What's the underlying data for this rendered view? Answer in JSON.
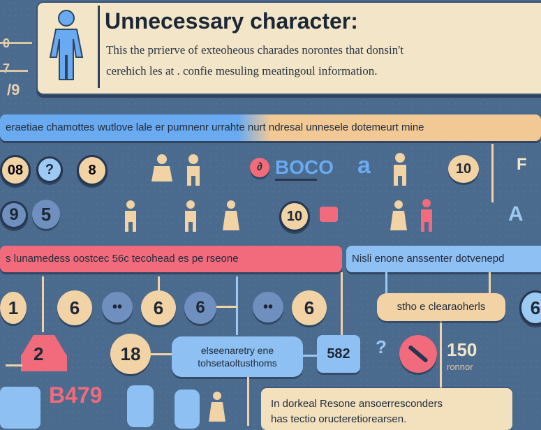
{
  "header": {
    "title": "Unnecessary character:",
    "line1": "This the prrierve of exteoheous charades norontes that donsin't",
    "line2": "cerehich les at . confie mesuling meatingoul information."
  },
  "banners": {
    "top": "eraetiae chamottes wutlove lale er pumnenr urrahte nurt ndresal unnesele dotemeurt mine",
    "red": "s lunamedess oostcec 56c tecohead es pe rseone",
    "blue": "Nisli enone anssenter dotvenepd"
  },
  "labels": {
    "beige_pill": "stho e clearaoherls",
    "blue_pill_line1": "elseenaretry ene",
    "blue_pill_line2": "tohsetaoltusthoms",
    "note_line1": "In dorkeal Resone ansoerresconders",
    "note_line2": "has tectio oructeretiorearsen."
  },
  "circles": {
    "r1": [
      "08",
      "?",
      "8",
      "10"
    ],
    "r2": [
      "9",
      "5",
      "10"
    ],
    "r3": [
      "1",
      "6",
      "6",
      "6",
      "6",
      "6"
    ],
    "r4": [
      "2",
      "18"
    ]
  },
  "glyphs": {
    "left_top": "0",
    "left_mid": "7",
    "left_low": "/9",
    "blue_box": "582",
    "code_box": "150",
    "code_sub": "ronnor",
    "big_num": "B479",
    "letter_a": "a",
    "letter_boc": "BOCO",
    "letter_f": "F",
    "letter_ab": "A"
  },
  "colors": {
    "background": "#4a6a8e",
    "beige": "#f2d3a5",
    "blue": "#6aaaf0",
    "red": "#f16b7c",
    "light_blue": "#9ccaf3",
    "dark": "#1d2735"
  }
}
